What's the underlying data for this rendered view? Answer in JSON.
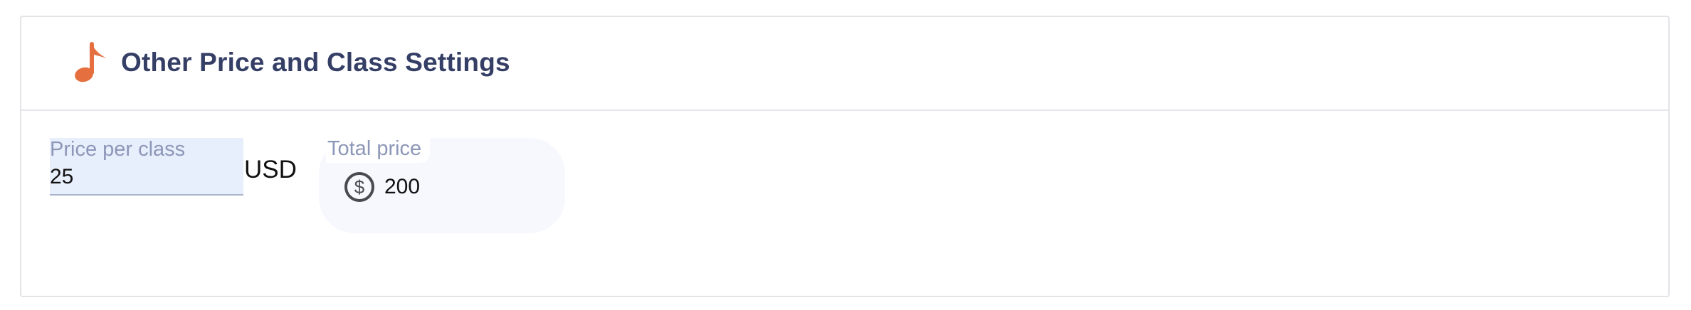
{
  "section": {
    "title": "Other Price and Class Settings",
    "icon": "music-note-icon",
    "icon_color": "#e56f3f"
  },
  "price_per_class": {
    "label": "Price per class",
    "value": "25",
    "currency": "USD"
  },
  "total_price": {
    "label": "Total price",
    "icon": "dollar-circle-icon",
    "value": "200"
  },
  "colors": {
    "title": "#353f66",
    "label": "#8d97b8",
    "input_bg": "#e7eefc",
    "total_bg": "#f7f8fe",
    "border": "#e3e3e8"
  }
}
